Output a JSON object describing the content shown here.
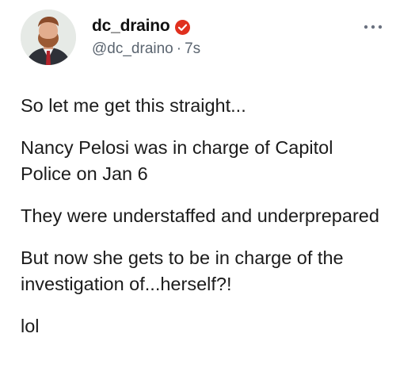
{
  "post": {
    "display_name": "dc_draino",
    "handle": "@dc_draino",
    "separator": "·",
    "time": "7s",
    "badge_icon": "verified-badge-icon",
    "badge_color": "#e0301e",
    "more_icon": "more-dots-icon",
    "avatar_icon": "avatar-photo",
    "paragraphs": [
      "So let me get this straight...",
      "Nancy Pelosi was in charge of Capitol Police on Jan 6",
      "They were understaffed and underprepared",
      "But now she gets to be in charge of the investigation of...herself?!",
      "lol"
    ]
  }
}
